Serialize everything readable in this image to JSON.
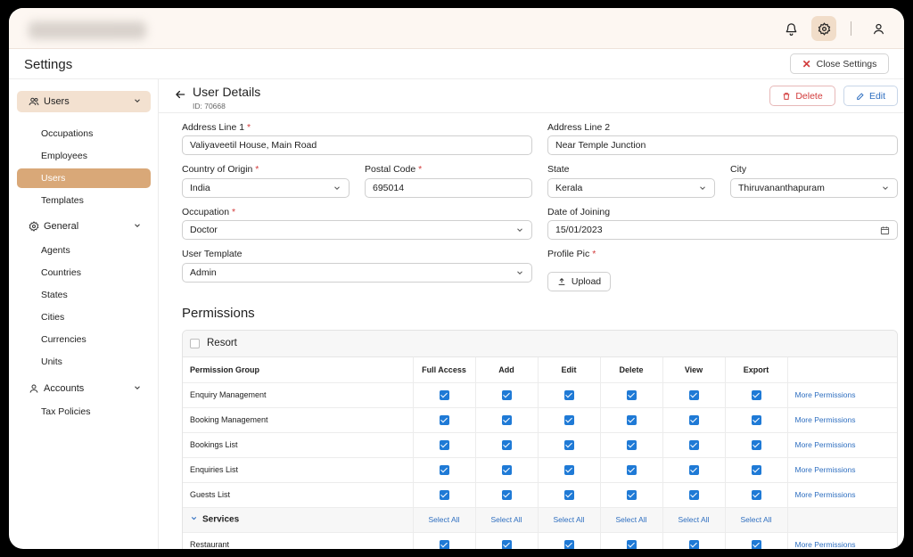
{
  "settings": {
    "title": "Settings",
    "close_label": "Close Settings"
  },
  "sidebar": {
    "groups": [
      {
        "label": "Users",
        "icon": "users-icon",
        "items": [
          "Occupations",
          "Employees",
          "Users",
          "Templates"
        ],
        "active": "Users"
      },
      {
        "label": "General",
        "icon": "gear-icon",
        "items": [
          "Agents",
          "Countries",
          "States",
          "Cities",
          "Currencies",
          "Units"
        ]
      },
      {
        "label": "Accounts",
        "icon": "user-icon",
        "items": [
          "Tax Policies"
        ]
      }
    ]
  },
  "header": {
    "title": "User Details",
    "id_text": "ID: 70668",
    "delete_label": "Delete",
    "edit_label": "Edit"
  },
  "form": {
    "address1": {
      "label": "Address Line 1",
      "value": "Valiyaveetil House, Main Road",
      "required": "*"
    },
    "address2": {
      "label": "Address Line 2",
      "value": "Near Temple Junction"
    },
    "country": {
      "label": "Country of Origin",
      "value": "India",
      "required": "*"
    },
    "postal": {
      "label": "Postal Code",
      "value": "695014",
      "required": "*"
    },
    "state": {
      "label": "State",
      "value": "Kerala"
    },
    "city": {
      "label": "City",
      "value": "Thiruvananthapuram"
    },
    "occupation": {
      "label": "Occupation",
      "value": "Doctor",
      "required": "*"
    },
    "joining": {
      "label": "Date of Joining",
      "value": "15/01/2023"
    },
    "template": {
      "label": "User Template",
      "value": "Admin"
    },
    "profile_pic": {
      "label": "Profile Pic",
      "required": "*",
      "upload_label": "Upload"
    }
  },
  "permissions": {
    "title": "Permissions",
    "group_name": "Resort",
    "columns": [
      "Permission Group",
      "Full Access",
      "Add",
      "Edit",
      "Delete",
      "View",
      "Export"
    ],
    "more_label": "More Permissions",
    "select_all_label": "Select All",
    "rows": [
      "Enquiry Management",
      "Booking Management",
      "Bookings List",
      "Enquiries List",
      "Guests List"
    ],
    "section": "Services",
    "section_rows": [
      "Restaurant"
    ]
  },
  "colors": {
    "accent": "#d9a878",
    "primary_blue": "#1f7ad6",
    "danger": "#d23b3b"
  }
}
